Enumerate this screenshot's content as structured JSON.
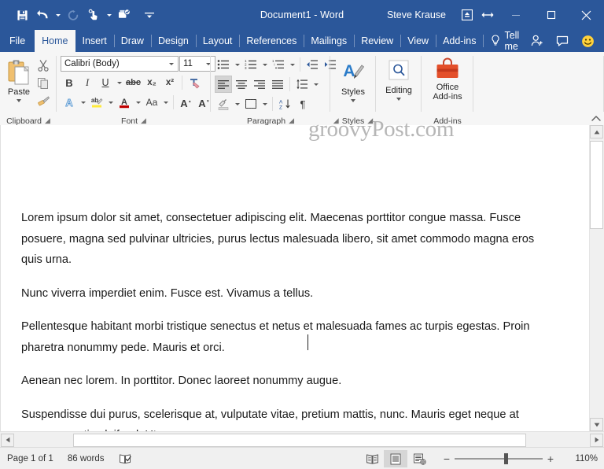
{
  "window": {
    "title": "Document1  -  Word",
    "account_name": "Steve Krause",
    "accent_color": "#2b579a",
    "quick_access": [
      {
        "name": "save-icon",
        "label": "Save"
      },
      {
        "name": "undo-icon",
        "label": "Undo"
      },
      {
        "name": "redo-icon",
        "label": "Redo"
      },
      {
        "name": "touch-mode-icon",
        "label": "Touch/Mouse Mode"
      },
      {
        "name": "start-inking-icon",
        "label": "Start Inking"
      },
      {
        "name": "customize-quick-access-toolbar-icon",
        "label": "Customize Quick Access Toolbar"
      }
    ],
    "controls": [
      {
        "name": "ribbon-display-options-icon",
        "label": "Ribbon Display Options"
      },
      {
        "name": "resize-icon",
        "label": "Resize"
      },
      {
        "name": "minimize-icon",
        "label": "Minimize"
      },
      {
        "name": "restore-icon",
        "label": "Restore Down"
      },
      {
        "name": "close-icon",
        "label": "Close"
      }
    ]
  },
  "tabs": [
    {
      "label": "File",
      "active": false
    },
    {
      "label": "Home",
      "active": true
    },
    {
      "label": "Insert",
      "active": false
    },
    {
      "label": "Draw",
      "active": false
    },
    {
      "label": "Design",
      "active": false
    },
    {
      "label": "Layout",
      "active": false
    },
    {
      "label": "References",
      "active": false
    },
    {
      "label": "Mailings",
      "active": false
    },
    {
      "label": "Review",
      "active": false
    },
    {
      "label": "View",
      "active": false
    },
    {
      "label": "Add-ins",
      "active": false
    }
  ],
  "tell_me": {
    "label": "Tell me",
    "icon": "lightbulb-icon"
  },
  "tab_bar_right": [
    {
      "name": "share-person-icon",
      "label": "Share"
    },
    {
      "name": "comments-icon",
      "label": "Comments"
    },
    {
      "name": "feedback-smiley-icon",
      "label": "Send a Smile"
    }
  ],
  "ribbon": {
    "groups": [
      {
        "name": "clipboard",
        "label": "Clipboard",
        "has_launcher": true,
        "big_button": {
          "label": "Paste",
          "icon": "paste-icon",
          "has_dropdown": true
        },
        "small_buttons": [
          {
            "name": "cut-icon",
            "label": "Cut"
          },
          {
            "name": "copy-icon",
            "label": "Copy"
          },
          {
            "name": "format-painter-icon",
            "label": "Format Painter"
          }
        ]
      },
      {
        "name": "font",
        "label": "Font",
        "has_launcher": true,
        "font_name": {
          "value": "Calibri (Body)",
          "placeholder": "Font"
        },
        "font_size": {
          "value": "11",
          "placeholder": "Size"
        },
        "row1": [
          {
            "name": "bold-button",
            "label": "B"
          },
          {
            "name": "italic-button",
            "label": "I"
          },
          {
            "name": "underline-button",
            "label": "U"
          },
          {
            "name": "strikethrough-button",
            "label": "abc"
          },
          {
            "name": "subscript-button",
            "label": "x₂"
          },
          {
            "name": "superscript-button",
            "label": "x²"
          },
          {
            "name": "clear-formatting-button",
            "label": "Clear All Formatting"
          }
        ],
        "row2": [
          {
            "name": "text-effects-button",
            "label": "A"
          },
          {
            "name": "text-highlight-color-button",
            "label": "ab"
          },
          {
            "name": "font-color-button",
            "label": "A"
          },
          {
            "name": "change-case-button",
            "label": "Aa"
          },
          {
            "name": "grow-font-button",
            "label": "A"
          },
          {
            "name": "shrink-font-button",
            "label": "A"
          }
        ]
      },
      {
        "name": "paragraph",
        "label": "Paragraph",
        "has_launcher": true,
        "row1": [
          {
            "name": "bullets-button",
            "label": "Bullets"
          },
          {
            "name": "numbering-button",
            "label": "Numbering"
          },
          {
            "name": "multilevel-list-button",
            "label": "Multilevel List"
          },
          {
            "name": "decrease-indent-button",
            "label": "Decrease Indent"
          },
          {
            "name": "increase-indent-button",
            "label": "Increase Indent"
          }
        ],
        "row2": [
          {
            "name": "align-left-button",
            "label": "Align Left",
            "active": true
          },
          {
            "name": "align-center-button",
            "label": "Center"
          },
          {
            "name": "align-right-button",
            "label": "Align Right"
          },
          {
            "name": "justify-button",
            "label": "Justify"
          },
          {
            "name": "line-spacing-button",
            "label": "Line and Paragraph Spacing"
          }
        ],
        "row3": [
          {
            "name": "shading-button",
            "label": "Shading"
          },
          {
            "name": "borders-button",
            "label": "Borders"
          },
          {
            "name": "sort-button",
            "label": "Sort"
          },
          {
            "name": "show-formatting-marks-button",
            "label": "¶"
          }
        ]
      },
      {
        "name": "styles",
        "label": "Styles",
        "has_launcher": true,
        "big_button": {
          "label": "Styles",
          "icon": "styles-icon",
          "has_dropdown": true
        }
      },
      {
        "name": "editing",
        "label": "",
        "has_launcher": false,
        "big_button": {
          "label": "Editing",
          "icon": "find-magnifier-icon",
          "has_dropdown": true
        }
      },
      {
        "name": "add-ins",
        "label": "Add-ins",
        "has_launcher": false,
        "big_button": {
          "label": "Office\nAdd-ins",
          "label_line1": "Office",
          "label_line2": "Add-ins",
          "icon": "office-store-briefcase-icon",
          "has_dropdown": false
        }
      }
    ],
    "collapse_icon": "collapse-ribbon-chevron-up-icon"
  },
  "document": {
    "watermark": "groovyPost.com",
    "paragraphs": [
      "Lorem ipsum dolor sit amet, consectetuer adipiscing elit. Maecenas porttitor congue massa. Fusce posuere, magna sed pulvinar ultricies, purus lectus malesuada libero, sit amet commodo magna eros quis urna.",
      "Nunc viverra imperdiet enim. Fusce est. Vivamus a tellus.",
      "Pellentesque habitant morbi tristique senectus et netus et malesuada fames ac turpis egestas. Proin pharetra nonummy pede. Mauris et orci.",
      "Aenean nec lorem. In porttitor. Donec laoreet nonummy augue.",
      "Suspendisse dui purus, scelerisque at, vulputate vitae, pretium mattis, nunc. Mauris eget neque at sem venenatis eleifend. Ut nonummy."
    ]
  },
  "status_bar": {
    "page": "Page 1 of 1",
    "words": "86 words",
    "proofing_icon": "proofing-errors-icon",
    "views": [
      {
        "name": "read-mode-button",
        "label": "Read Mode",
        "active": false
      },
      {
        "name": "print-layout-button",
        "label": "Print Layout",
        "active": true
      },
      {
        "name": "web-layout-button",
        "label": "Web Layout",
        "active": false
      }
    ],
    "zoom_out": "−",
    "zoom_in": "+",
    "zoom_level": "110%"
  },
  "scrollbars": {
    "vertical_up": "▲",
    "vertical_down": "▼",
    "horizontal_left": "◀",
    "horizontal_right": "▶"
  }
}
